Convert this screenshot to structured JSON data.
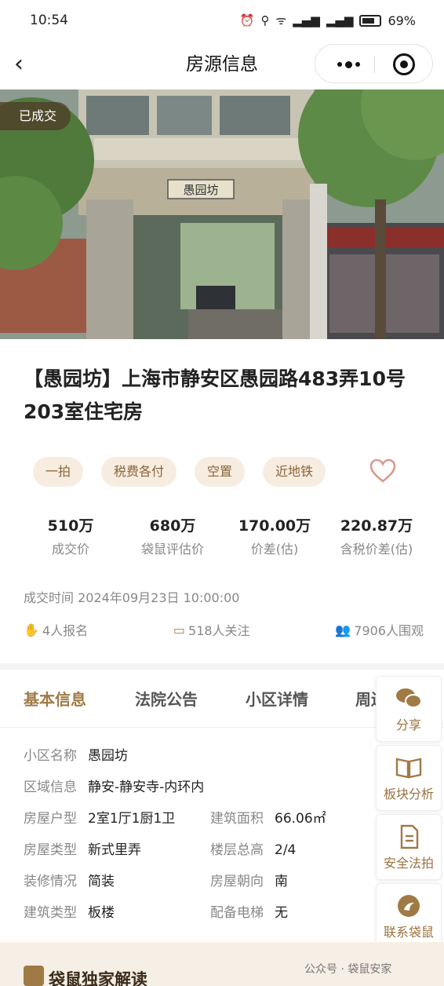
{
  "status": {
    "time": "10:54",
    "battery": "69%"
  },
  "nav": {
    "title": "房源信息"
  },
  "photo": {
    "badge": "已成交",
    "sign_text": "愚园坊"
  },
  "listing": {
    "title": "【愚园坊】上海市静安区愚园路483弄10号203室住宅房",
    "tags": [
      "一拍",
      "税费各付",
      "空置",
      "近地铁"
    ],
    "stats": [
      {
        "value": "510万",
        "label": "成交价"
      },
      {
        "value": "680万",
        "label": "袋鼠评估价"
      },
      {
        "value": "170.00万",
        "label": "价差(估)"
      },
      {
        "value": "220.87万",
        "label": "含税价差(估)"
      }
    ],
    "deal_time": "成交时间 2024年09月23日 10:00:00",
    "counters": {
      "signups": "4人报名",
      "followers": "518人关注",
      "viewers": "7906人围观"
    }
  },
  "tabs": [
    "基本信息",
    "法院公告",
    "小区详情",
    "周边配套"
  ],
  "info": {
    "community": {
      "label": "小区名称",
      "value": "愚园坊"
    },
    "region": {
      "label": "区域信息",
      "value": "静安-静安寺-内环内"
    },
    "layout": {
      "label": "房屋户型",
      "value": "2室1厅1厨1卫"
    },
    "area": {
      "label": "建筑面积",
      "value": "66.06㎡"
    },
    "house_type": {
      "label": "房屋类型",
      "value": "新式里弄"
    },
    "floor": {
      "label": "楼层总高",
      "value": "2/4"
    },
    "decoration": {
      "label": "装修情况",
      "value": "简装"
    },
    "orientation": {
      "label": "房屋朝向",
      "value": "南"
    },
    "building_type": {
      "label": "建筑类型",
      "value": "板楼"
    },
    "elevator": {
      "label": "配备电梯",
      "value": "无"
    }
  },
  "side_buttons": [
    "分享",
    "板块分析",
    "安全法拍",
    "联系袋鼠"
  ],
  "bottom": {
    "title": "袋鼠独家解读",
    "watermark": "公众号 · 袋鼠安家"
  },
  "colors": {
    "accent": "#a07a45",
    "tag_bg": "#f7ece0",
    "heart": "#d99a8c"
  }
}
